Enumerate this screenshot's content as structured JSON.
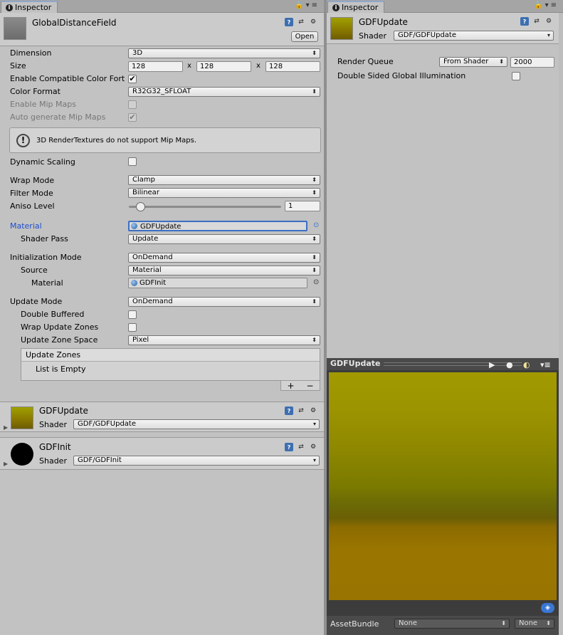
{
  "left": {
    "tab": "Inspector",
    "header": {
      "title": "GlobalDistanceField",
      "open": "Open"
    },
    "dimension": {
      "label": "Dimension",
      "value": "3D"
    },
    "size": {
      "label": "Size",
      "x": "128",
      "y": "128",
      "z": "128",
      "sep": "x"
    },
    "compat": {
      "label": "Enable Compatible Color Fort",
      "checked": "✔"
    },
    "color_format": {
      "label": "Color Format",
      "value": "R32G32_SFLOAT"
    },
    "mip": {
      "label": "Enable Mip Maps"
    },
    "auto_mip": {
      "label": "Auto generate Mip Maps",
      "checked": "✔"
    },
    "help": {
      "icon": "!",
      "text": "3D RenderTextures do not support Mip Maps."
    },
    "dynamic": {
      "label": "Dynamic Scaling"
    },
    "wrap": {
      "label": "Wrap Mode",
      "value": "Clamp"
    },
    "filter": {
      "label": "Filter Mode",
      "value": "Bilinear"
    },
    "aniso": {
      "label": "Aniso Level",
      "value": "1"
    },
    "material": {
      "label": "Material",
      "value": "GDFUpdate"
    },
    "shader_pass": {
      "label": "Shader Pass",
      "value": "Update"
    },
    "init_mode": {
      "label": "Initialization Mode",
      "value": "OnDemand"
    },
    "source": {
      "label": "Source",
      "value": "Material"
    },
    "init_material": {
      "label": "Material",
      "value": "GDFInit"
    },
    "update_mode": {
      "label": "Update Mode",
      "value": "OnDemand"
    },
    "double_buffered": {
      "label": "Double Buffered"
    },
    "wrap_zones": {
      "label": "Wrap Update Zones"
    },
    "zone_space": {
      "label": "Update Zone Space",
      "value": "Pixel"
    },
    "zones": {
      "header": "Update Zones",
      "empty": "List is Empty",
      "plus": "+",
      "minus": "−"
    },
    "mat1": {
      "title": "GDFUpdate",
      "shader_label": "Shader",
      "shader": "GDF/GDFUpdate"
    },
    "mat2": {
      "title": "GDFInit",
      "shader_label": "Shader",
      "shader": "GDF/GDFInit"
    }
  },
  "right": {
    "tab": "Inspector",
    "header": {
      "title": "GDFUpdate",
      "shader_label": "Shader",
      "shader": "GDF/GDFUpdate"
    },
    "render_queue": {
      "label": "Render Queue",
      "mode": "From Shader",
      "value": "2000"
    },
    "dsgi": {
      "label": "Double Sided Global Illumination"
    },
    "preview": {
      "title": "GDFUpdate"
    },
    "assetbundle": {
      "label": "AssetBundle",
      "name": "None",
      "variant": "None"
    }
  }
}
